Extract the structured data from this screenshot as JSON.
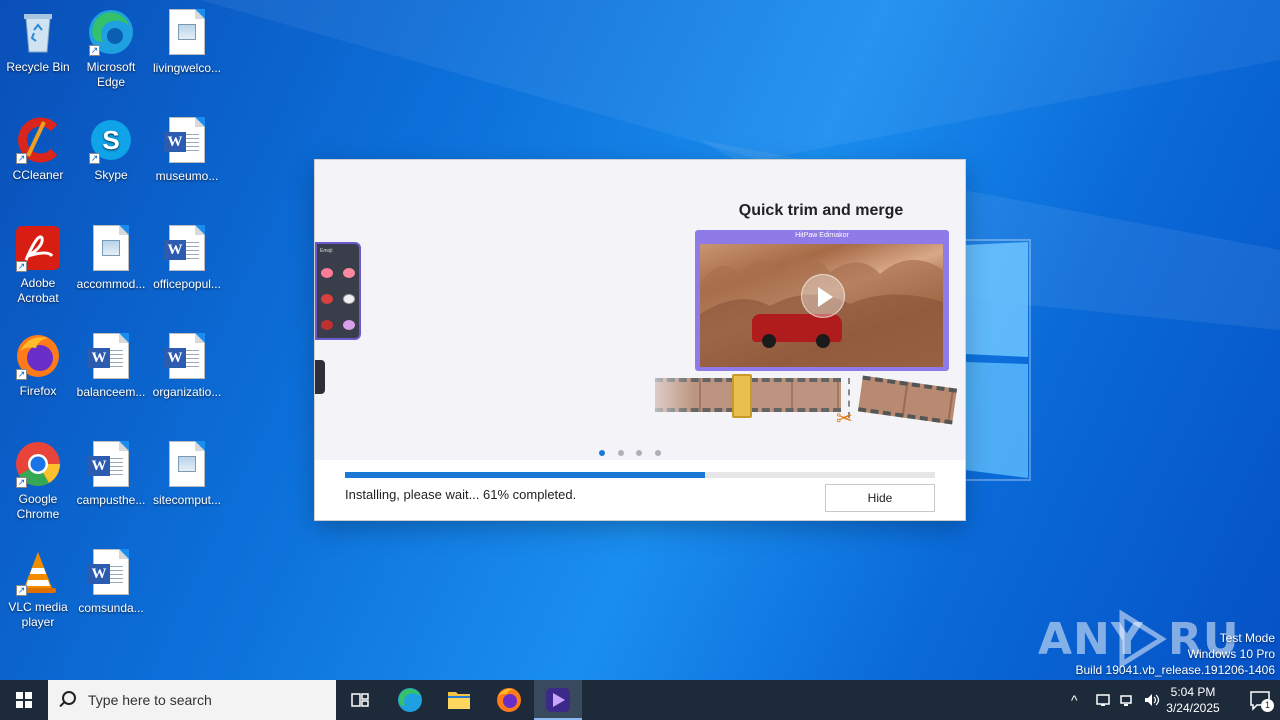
{
  "desktop": {
    "icons": [
      {
        "label": "Recycle Bin"
      },
      {
        "label": "Microsoft Edge"
      },
      {
        "label": "livingwelco..."
      },
      {
        "label": "CCleaner"
      },
      {
        "label": "Skype"
      },
      {
        "label": "museumo..."
      },
      {
        "label": "Adobe Acrobat"
      },
      {
        "label": "accommod..."
      },
      {
        "label": "officepopul..."
      },
      {
        "label": "Firefox"
      },
      {
        "label": "balanceem..."
      },
      {
        "label": "organizatio..."
      },
      {
        "label": "Google Chrome"
      },
      {
        "label": "campusthe..."
      },
      {
        "label": "sitecomput..."
      },
      {
        "label": "VLC media player"
      },
      {
        "label": "comsunda..."
      }
    ]
  },
  "installer": {
    "slide_title": "Quick trim and merge",
    "video_brand": "HitPaw Edimakor",
    "phone_label": "Emoji",
    "dots_active_index": 0,
    "progress_fraction": 0.61,
    "status_text": "Installing, please wait... 61% completed.",
    "hide_label": "Hide",
    "accent_color": "#1a78d6"
  },
  "watermark": {
    "text": "ANY RUN",
    "test_mode": "Test Mode",
    "os": "Windows 10 Pro",
    "build": "Build 19041.vb_release.191206-1406"
  },
  "taskbar": {
    "search_placeholder": "Type here to search",
    "time": "5:04 PM",
    "date": "3/24/2025",
    "notification_count": "1"
  }
}
